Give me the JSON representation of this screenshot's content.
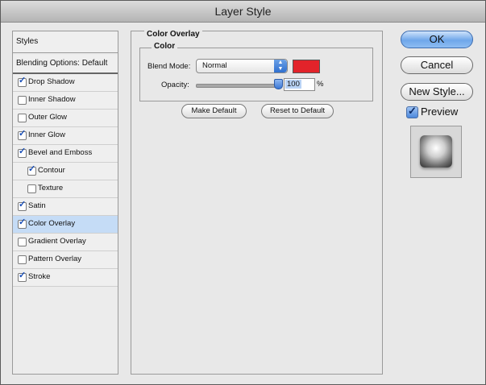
{
  "window": {
    "title": "Layer Style"
  },
  "sidebar": {
    "header": "Styles",
    "blending_options": "Blending Options: Default",
    "items": [
      {
        "label": "Drop Shadow",
        "checked": true,
        "sub": false,
        "selected": false
      },
      {
        "label": "Inner Shadow",
        "checked": false,
        "sub": false,
        "selected": false
      },
      {
        "label": "Outer Glow",
        "checked": false,
        "sub": false,
        "selected": false
      },
      {
        "label": "Inner Glow",
        "checked": true,
        "sub": false,
        "selected": false
      },
      {
        "label": "Bevel and Emboss",
        "checked": true,
        "sub": false,
        "selected": false
      },
      {
        "label": "Contour",
        "checked": true,
        "sub": true,
        "selected": false
      },
      {
        "label": "Texture",
        "checked": false,
        "sub": true,
        "selected": false
      },
      {
        "label": "Satin",
        "checked": true,
        "sub": false,
        "selected": false
      },
      {
        "label": "Color Overlay",
        "checked": true,
        "sub": false,
        "selected": true
      },
      {
        "label": "Gradient Overlay",
        "checked": false,
        "sub": false,
        "selected": false
      },
      {
        "label": "Pattern Overlay",
        "checked": false,
        "sub": false,
        "selected": false
      },
      {
        "label": "Stroke",
        "checked": true,
        "sub": false,
        "selected": false
      }
    ]
  },
  "panel": {
    "title": "Color Overlay",
    "group_title": "Color",
    "blend_mode_label": "Blend Mode:",
    "blend_mode_value": "Normal",
    "overlay_color": "#e2232a",
    "opacity_label": "Opacity:",
    "opacity_value": "100",
    "opacity_unit": "%",
    "opacity_fraction": 1.0,
    "make_default": "Make Default",
    "reset_default": "Reset to Default"
  },
  "actions": {
    "ok": "OK",
    "cancel": "Cancel",
    "new_style": "New Style...",
    "preview_label": "Preview",
    "preview_checked": true
  },
  "colors": {
    "selection": "#c5dcf6",
    "accent": "#3b78d6"
  }
}
